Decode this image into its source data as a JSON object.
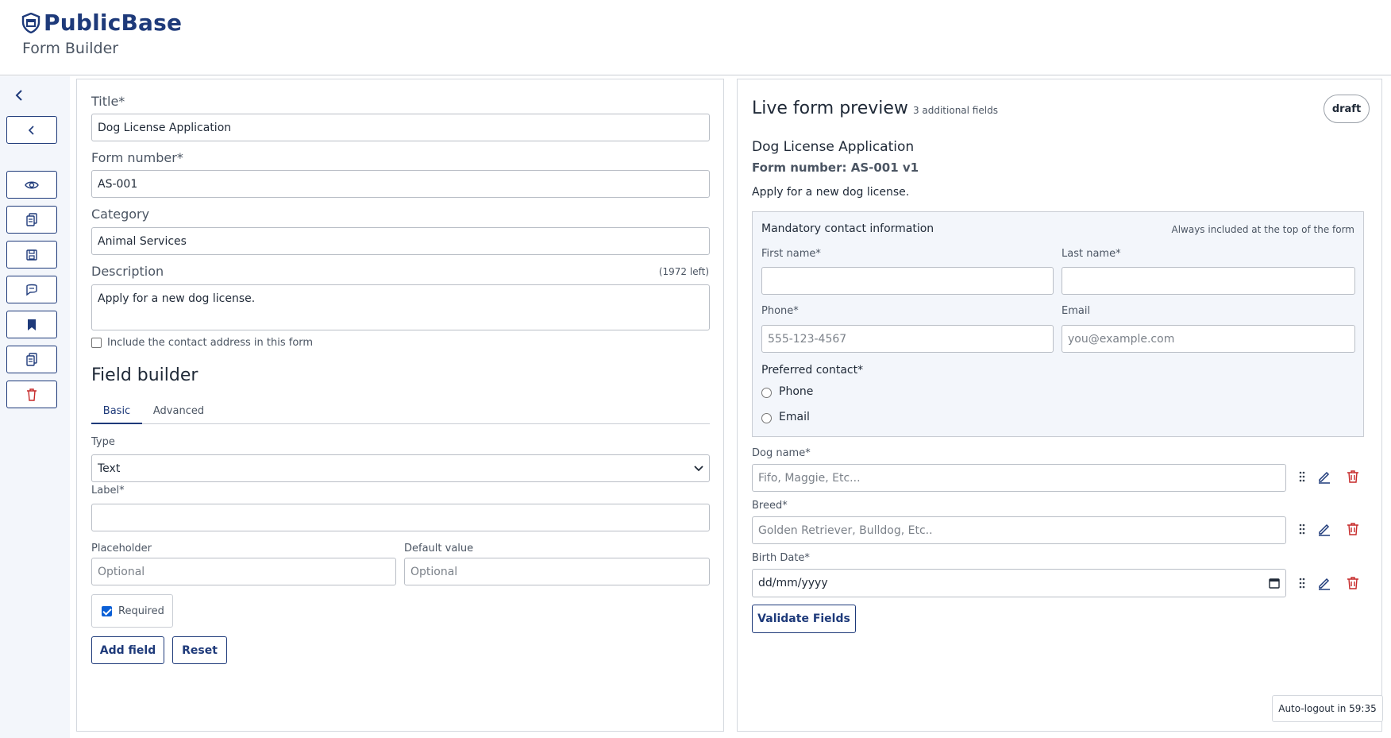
{
  "app": {
    "brand": "PublicBase",
    "subtitle": "Form Builder"
  },
  "sidebar": {
    "icons": [
      "chevron-left-icon",
      "back-icon",
      "eye-icon",
      "copy-icon",
      "save-icon",
      "comment-icon",
      "bookmark-icon",
      "duplicate-icon",
      "trash-icon"
    ]
  },
  "editor": {
    "title_label": "Title*",
    "title_value": "Dog License Application",
    "form_number_label": "Form number*",
    "form_number_value": "AS-001",
    "category_label": "Category",
    "category_value": "Animal Services",
    "description_label": "Description",
    "description_counter": "(1972 left)",
    "description_value": "Apply for a new dog license.",
    "include_address_label": "Include the contact address in this form",
    "field_builder_title": "Field builder",
    "tabs": [
      "Basic",
      "Advanced"
    ],
    "type_label": "Type",
    "type_value": "Text",
    "label_label": "Label*",
    "label_value": "",
    "placeholder_label": "Placeholder",
    "placeholder_placeholder": "Optional",
    "default_label": "Default value",
    "default_placeholder": "Optional",
    "required_label": "Required",
    "add_field": "Add field",
    "reset": "Reset"
  },
  "preview": {
    "heading": "Live form preview",
    "count": "3 additional fields",
    "status": "draft",
    "form_title": "Dog License Application",
    "form_number": "Form number: AS-001 v1",
    "description": "Apply for a new dog license.",
    "contact": {
      "title": "Mandatory contact information",
      "note": "Always included at the top of the form",
      "first_name": "First name*",
      "last_name": "Last name*",
      "phone": "Phone*",
      "phone_placeholder": "555-123-4567",
      "email": "Email",
      "email_placeholder": "you@example.com",
      "preferred": "Preferred contact*",
      "options": [
        "Phone",
        "Email"
      ]
    },
    "fields": [
      {
        "label": "Dog name*",
        "placeholder": "Fifo, Maggie, Etc..."
      },
      {
        "label": "Breed*",
        "placeholder": "Golden Retriever, Bulldog, Etc.."
      },
      {
        "label": "Birth Date*",
        "placeholder": "dd/mm/yyyy"
      }
    ],
    "validate": "Validate Fields"
  },
  "footer": {
    "autologout": "Auto-logout in 59:35"
  },
  "colors": {
    "primary": "#1e3a7a",
    "danger": "#c62828",
    "panel_bg": "#f3f6fb"
  }
}
